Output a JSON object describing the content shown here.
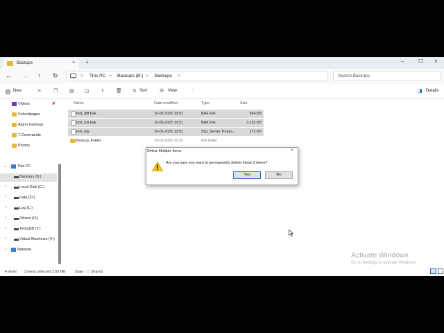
{
  "tab": {
    "title": "Backups",
    "close": "×",
    "new": "+"
  },
  "window_controls": {
    "minimize": "–",
    "maximize": "☐",
    "close": "×"
  },
  "nav": {
    "back": "←",
    "forward": "→",
    "up": "↑",
    "refresh": "↻",
    "breadcrumb": [
      "This PC",
      "Backups (B:)",
      "Backups"
    ],
    "sep": ">",
    "search_placeholder": "Search Backups"
  },
  "toolbar": {
    "new": "New",
    "sort": "Sort",
    "view": "View",
    "more": "···",
    "details": "Details"
  },
  "sidebar": {
    "quick": [
      {
        "label": "Videos",
        "pin": "📌",
        "color": "#6a3fb3"
      },
      {
        "label": "Solvedpages",
        "color": "#e8b639"
      },
      {
        "label": "Algno trainings",
        "color": "#e8b639"
      },
      {
        "label": "7.Commands",
        "color": "#e8b639"
      },
      {
        "label": "Photos",
        "color": "#e8b639"
      }
    ],
    "this_pc": "This PC",
    "drives": [
      {
        "label": "Backups (B:)",
        "selected": true
      },
      {
        "label": "Local Disk (C:)"
      },
      {
        "label": "Data (D:)"
      },
      {
        "label": "Log (L:)"
      },
      {
        "label": "Others (O:)"
      },
      {
        "label": "TempDB (T:)"
      },
      {
        "label": "Virtual Machines (V:)"
      }
    ],
    "network": "Network"
  },
  "columns": {
    "name": "Name",
    "date": "Date modified",
    "type": "Type",
    "size": "Size"
  },
  "files": [
    {
      "name": "test_diff.bak",
      "date": "10-05-2025 10:51",
      "type": "BAK File",
      "size": "564 KB",
      "selected": true,
      "folder": false
    },
    {
      "name": "test_full.bak",
      "date": "10-05-2025 10:51",
      "type": "BAK File",
      "size": "3,252 KB",
      "selected": true,
      "folder": false
    },
    {
      "name": "test_log",
      "date": "10-05-2025 10:51",
      "type": "SQL Server Transa...",
      "size": "172 KB",
      "selected": true,
      "folder": false
    },
    {
      "name": "Backup_Folder",
      "date": "10-05-2025 10:32",
      "type": "File folder",
      "size": "",
      "selected": false,
      "folder": true
    }
  ],
  "status": {
    "count": "4 items",
    "selected": "3 items selected  3.89 MB",
    "state_label": "State:",
    "state_value": "Shared"
  },
  "dialog": {
    "title": "Delete Multiple Items",
    "close": "×",
    "message": "Are you sure you want to permanently delete these 3 items?",
    "yes": "Yes",
    "no": "No"
  },
  "watermark": {
    "line1": "Activate Windows",
    "line2": "Go to Settings to activate Windows."
  }
}
